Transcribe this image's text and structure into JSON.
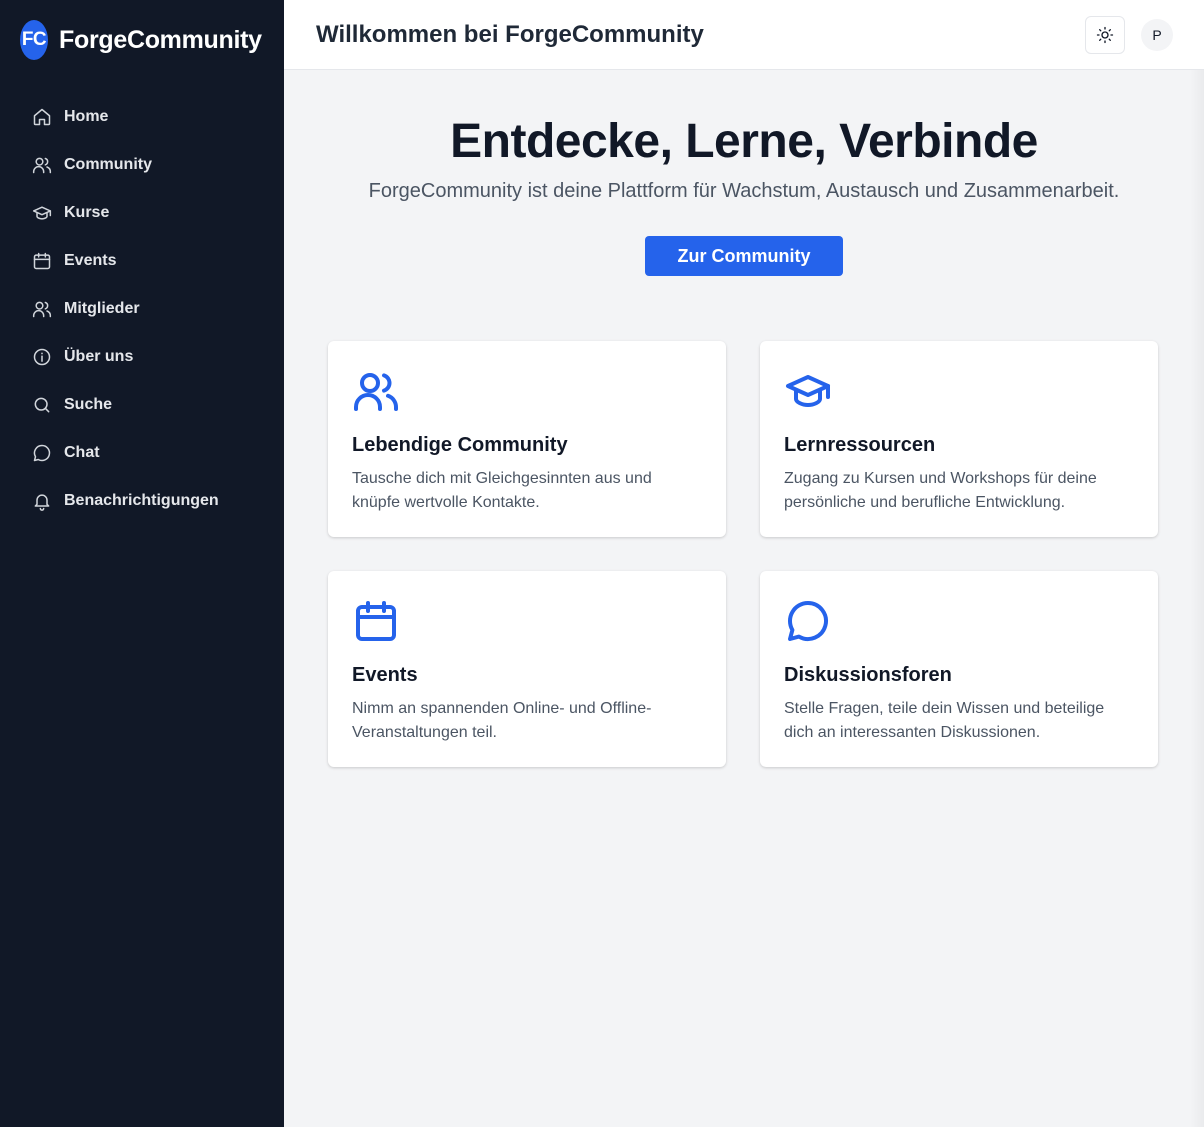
{
  "brand": {
    "logo": "FC",
    "name": "ForgeCommunity"
  },
  "sidebar": {
    "items": [
      {
        "label": "Home",
        "icon": "home-icon"
      },
      {
        "label": "Community",
        "icon": "users-icon"
      },
      {
        "label": "Kurse",
        "icon": "graduation-cap-icon"
      },
      {
        "label": "Events",
        "icon": "calendar-icon"
      },
      {
        "label": "Mitglieder",
        "icon": "users-icon"
      },
      {
        "label": "Über uns",
        "icon": "info-icon"
      },
      {
        "label": "Suche",
        "icon": "search-icon"
      },
      {
        "label": "Chat",
        "icon": "chat-bubble-icon"
      },
      {
        "label": "Benachrichtigungen",
        "icon": "bell-icon"
      }
    ]
  },
  "header": {
    "title": "Willkommen bei ForgeCommunity",
    "theme_toggle_icon": "sun-icon",
    "avatar_initial": "P"
  },
  "hero": {
    "title": "Entdecke, Lerne, Verbinde",
    "subtitle": "ForgeCommunity ist deine Plattform für Wachstum, Austausch und Zusammenarbeit.",
    "cta_label": "Zur Community"
  },
  "features": [
    {
      "icon": "users-icon",
      "title": "Lebendige Community",
      "text": "Tausche dich mit Gleichgesinnten aus und knüpfe wertvolle Kontakte."
    },
    {
      "icon": "graduation-cap-icon",
      "title": "Lernressourcen",
      "text": "Zugang zu Kursen und Workshops für deine persönliche und berufliche Entwicklung."
    },
    {
      "icon": "calendar-icon",
      "title": "Events",
      "text": "Nimm an spannenden Online- und Offline-Veranstaltungen teil."
    },
    {
      "icon": "chat-bubble-icon",
      "title": "Diskussionsforen",
      "text": "Stelle Fragen, teile dein Wissen und beteilige dich an interessanten Diskussionen."
    }
  ],
  "colors": {
    "sidebar_bg": "#111827",
    "accent": "#2563eb",
    "page_bg": "#f3f4f6"
  }
}
